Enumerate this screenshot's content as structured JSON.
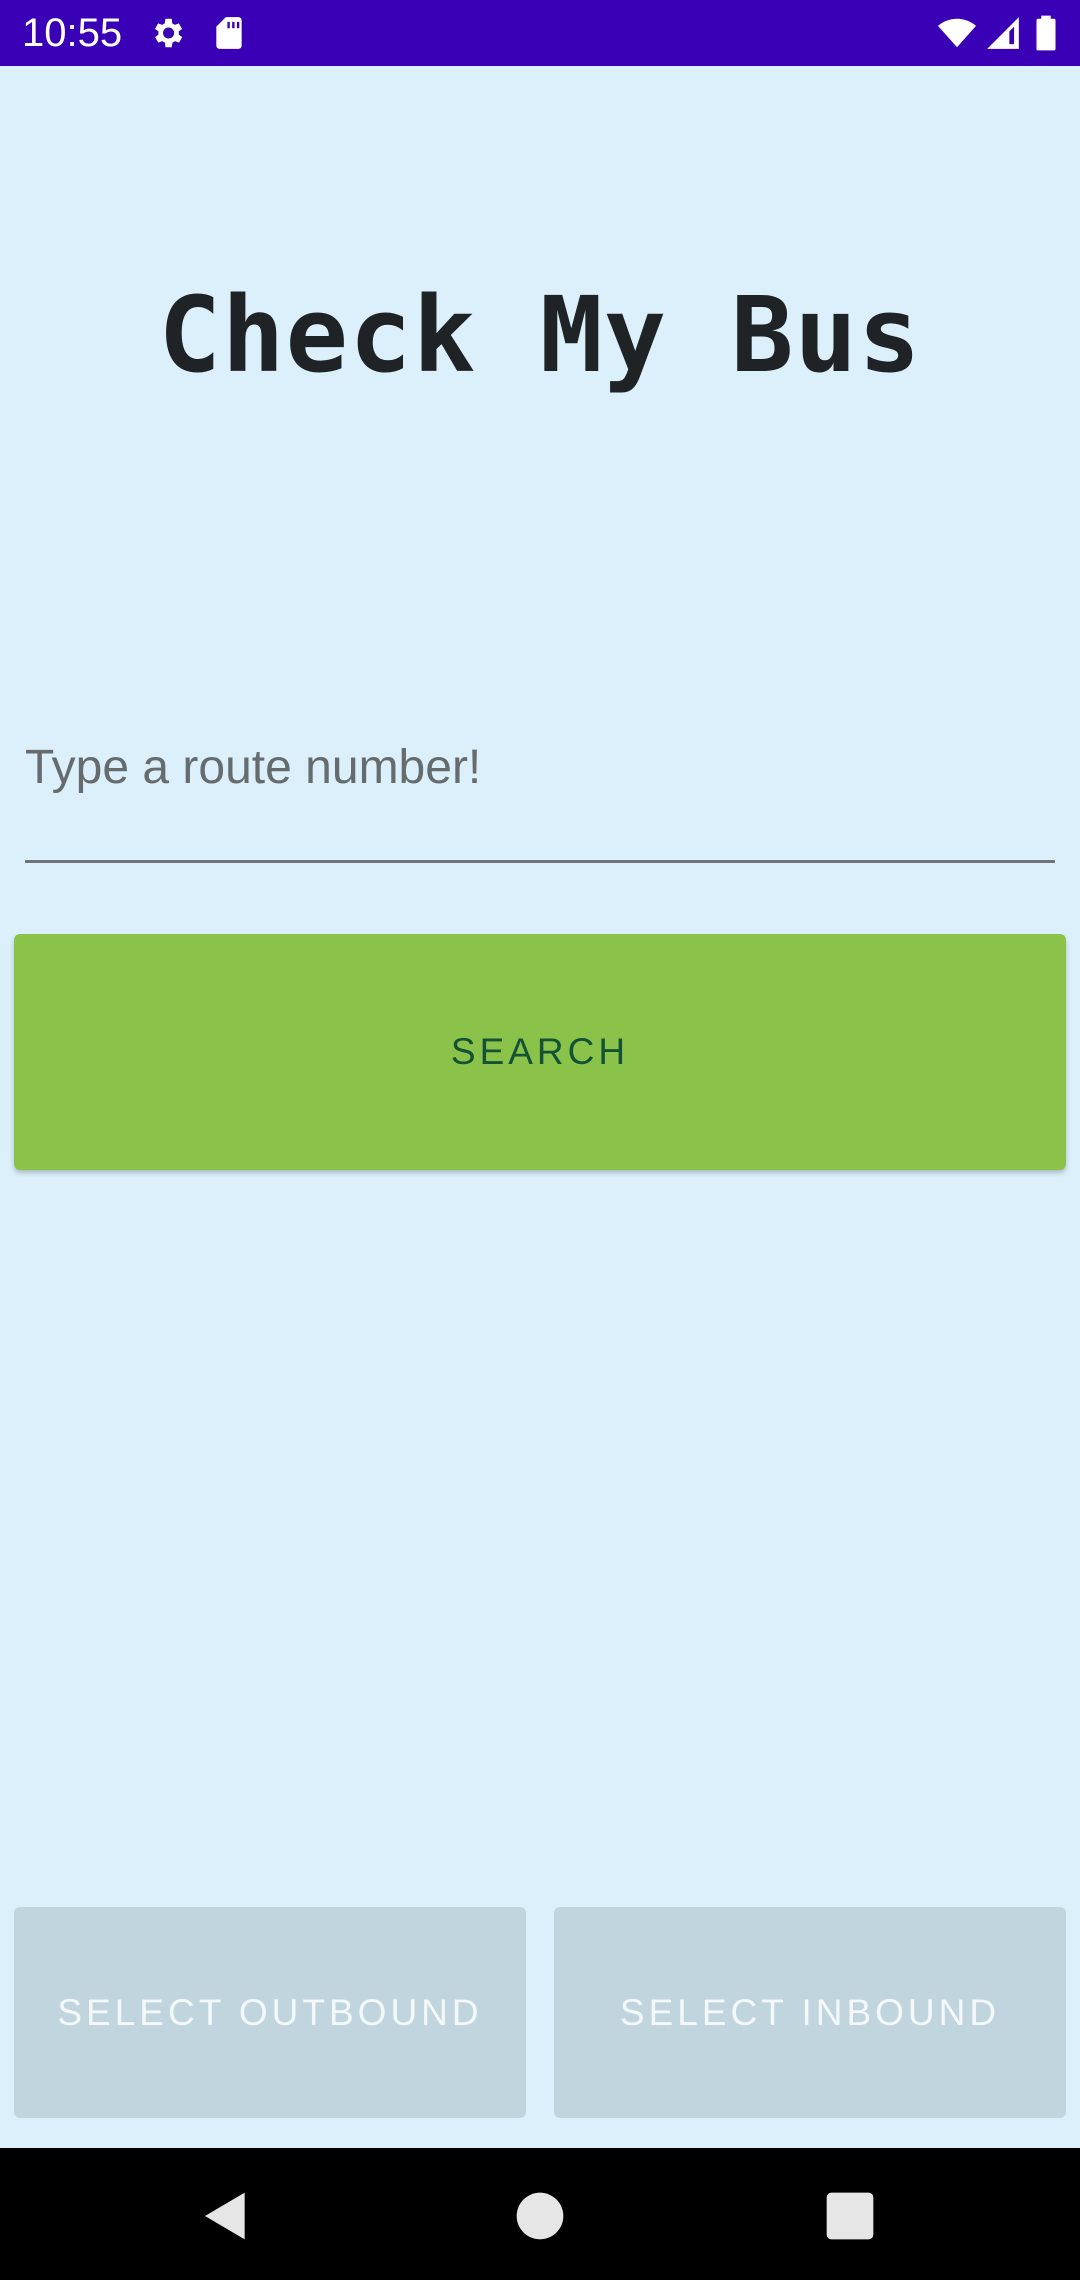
{
  "status_bar": {
    "time": "10:55",
    "background": "#3a00b5",
    "icons": [
      "settings-icon",
      "sd-card-icon",
      "wifi-icon",
      "cell-signal-icon",
      "battery-icon"
    ]
  },
  "app": {
    "title": "Check My Bus"
  },
  "search": {
    "placeholder": "Type a route number!",
    "value": "",
    "button_label": "SEARCH",
    "button_color": "#8bc34a"
  },
  "direction": {
    "outbound_label": "SELECT OUTBOUND",
    "inbound_label": "SELECT INBOUND",
    "disabled_color": "#c0d5dd"
  },
  "nav_bar": {
    "icons": [
      "back-icon",
      "home-icon",
      "recents-icon"
    ]
  }
}
